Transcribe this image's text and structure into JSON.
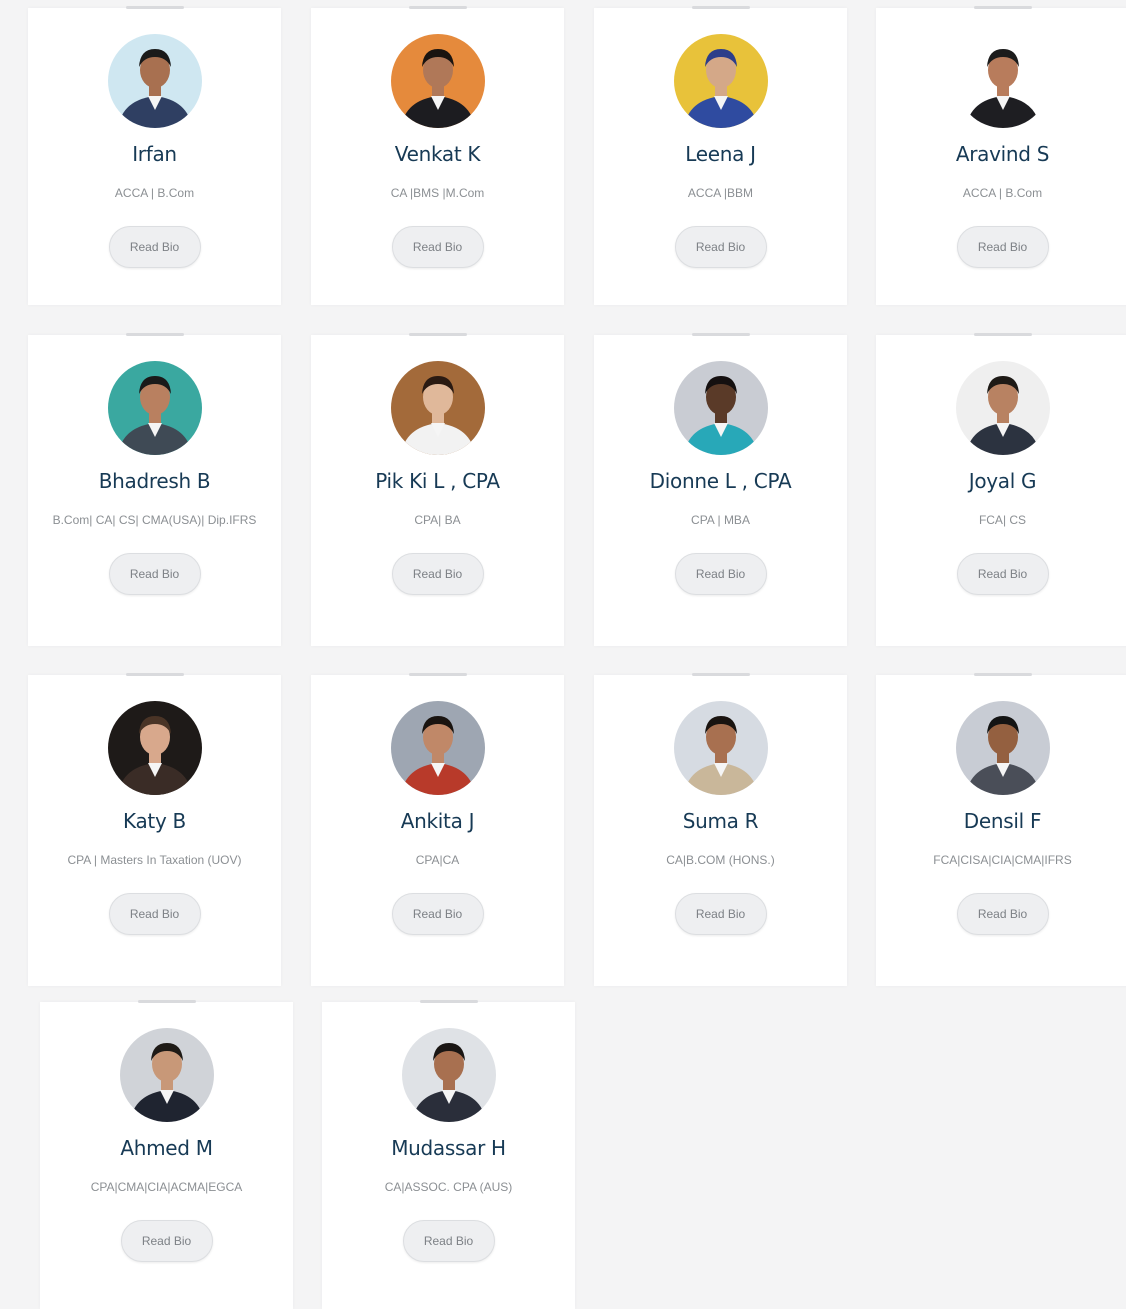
{
  "read_bio_label": "Read Bio",
  "profiles": [
    {
      "name": "Irfan",
      "quals": "ACCA | B.Com",
      "avatar_icon": "person-photo-icon",
      "bg": "#cfe7f1",
      "skin": "#a87050",
      "hair": "#1a1a1a",
      "suit": "#2f3f62"
    },
    {
      "name": "Venkat K",
      "quals": "CA |BMS |M.Com",
      "avatar_icon": "person-photo-icon",
      "bg": "#e58a3c",
      "skin": "#b07858",
      "hair": "#1a1410",
      "suit": "#1c1c20"
    },
    {
      "name": "Leena J",
      "quals": "ACCA |BBM",
      "avatar_icon": "person-photo-icon",
      "bg": "#e8c23a",
      "skin": "#d4a888",
      "hair": "#2c3e8a",
      "suit": "#2f4ba0"
    },
    {
      "name": "Aravind S",
      "quals": "ACCA | B.Com",
      "avatar_icon": "person-photo-icon",
      "bg": "#ffffff",
      "skin": "#b87c5c",
      "hair": "#1c1c1c",
      "suit": "#1e1e22"
    },
    {
      "name": "Bhadresh B",
      "quals": "B.Com| CA| CS| CMA(USA)| Dip.IFRS",
      "avatar_icon": "person-photo-icon",
      "bg": "#3aa8a0",
      "skin": "#b98060",
      "hair": "#1a1a1a",
      "suit": "#3f4a55"
    },
    {
      "name": "Pik Ki L , CPA",
      "quals": "CPA| BA",
      "avatar_icon": "person-photo-icon",
      "bg": "#a36a3a",
      "skin": "#e0b89a",
      "hair": "#2a1a12",
      "suit": "#f2f2f2"
    },
    {
      "name": "Dionne L , CPA",
      "quals": "CPA | MBA",
      "avatar_icon": "person-photo-icon",
      "bg": "#c9ccd3",
      "skin": "#5a3a28",
      "hair": "#151010",
      "suit": "#28a8b8"
    },
    {
      "name": "Joyal G",
      "quals": "FCA| CS",
      "avatar_icon": "person-photo-icon",
      "bg": "#efefef",
      "skin": "#b88262",
      "hair": "#1e1a16",
      "suit": "#2c3340"
    },
    {
      "name": "Katy B",
      "quals": "CPA | Masters In Taxation (UOV)",
      "avatar_icon": "person-photo-icon",
      "bg": "#1e1a18",
      "skin": "#d8a88c",
      "hair": "#4a3426",
      "suit": "#3a2c26"
    },
    {
      "name": "Ankita J",
      "quals": "CPA|CA",
      "avatar_icon": "person-photo-icon",
      "bg": "#9ea6b2",
      "skin": "#c08868",
      "hair": "#1a1410",
      "suit": "#b83a2a"
    },
    {
      "name": "Suma R",
      "quals": "CA|B.COM (HONS.)",
      "avatar_icon": "person-photo-icon",
      "bg": "#d6dbe2",
      "skin": "#a87050",
      "hair": "#1a1410",
      "suit": "#c9b79a"
    },
    {
      "name": "Densil F",
      "quals": "FCA|CISA|CIA|CMA|IFRS",
      "avatar_icon": "person-photo-icon",
      "bg": "#c8ccd4",
      "skin": "#946040",
      "hair": "#141414",
      "suit": "#4a4e58"
    },
    {
      "name": "Ahmed M",
      "quals": "CPA|CMA|CIA|ACMA|EGCA",
      "avatar_icon": "person-photo-icon",
      "bg": "#d0d3d8",
      "skin": "#c89878",
      "hair": "#1e1a16",
      "suit": "#1f2430"
    },
    {
      "name": "Mudassar H",
      "quals": "CA|ASSOC. CPA (AUS)",
      "avatar_icon": "person-photo-icon",
      "bg": "#dfe2e6",
      "skin": "#a87050",
      "hair": "#1a1614",
      "suit": "#2a2e3a"
    }
  ]
}
